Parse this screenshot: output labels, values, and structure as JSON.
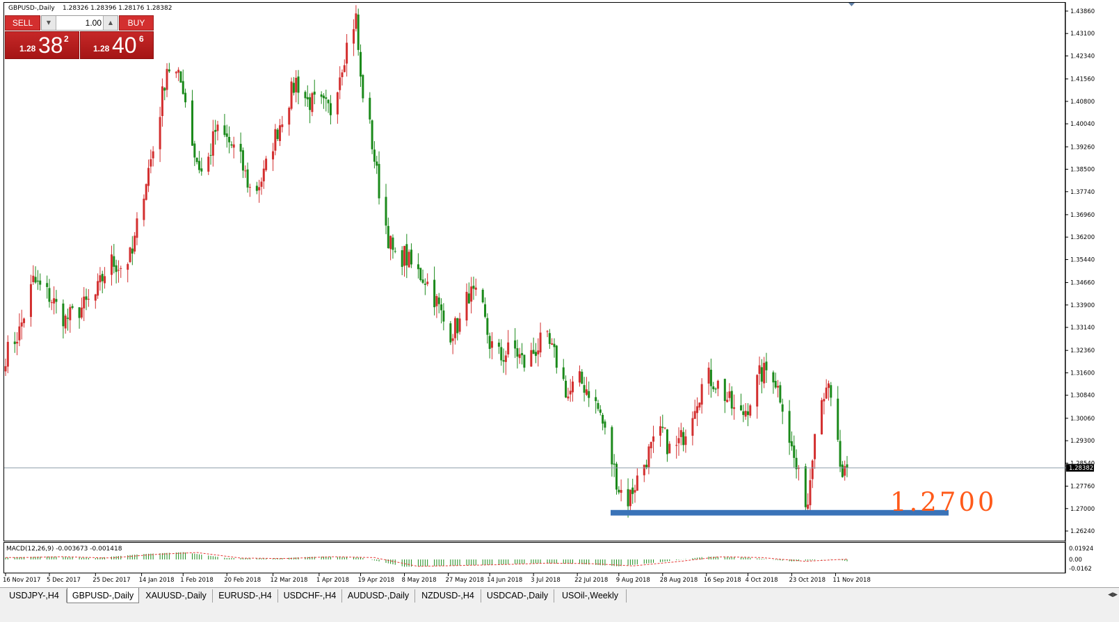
{
  "chart_title": "GBPUSD-,Daily",
  "chart_ohlc": "1.28326 1.28396 1.28176 1.28382",
  "trade_panel": {
    "sell_label": "SELL",
    "buy_label": "BUY",
    "lot_value": "1.00",
    "sell_price": {
      "small": "1.28",
      "big": "38",
      "sup": "2"
    },
    "buy_price": {
      "small": "1.28",
      "big": "40",
      "sup": "6"
    }
  },
  "annotation_text": "1.2700",
  "current_price_label": "1.28382",
  "macd": {
    "label": "MACD(12,26,9) -0.003673 -0.001418",
    "axis_labels": [
      "0.01924",
      "0.00",
      "-0.0162"
    ]
  },
  "tabs": [
    {
      "label": "USDJPY-,H4",
      "active": false
    },
    {
      "label": "GBPUSD-,Daily",
      "active": true
    },
    {
      "label": "XAUUSD-,Daily",
      "active": false
    },
    {
      "label": "EURUSD-,H4",
      "active": false
    },
    {
      "label": "USDCHF-,H4",
      "active": false
    },
    {
      "label": "AUDUSD-,Daily",
      "active": false
    },
    {
      "label": "NZDUSD-,H4",
      "active": false
    },
    {
      "label": "USDCAD-,Daily",
      "active": false
    },
    {
      "label": "USOil-,Weekly",
      "active": false
    }
  ],
  "colors": {
    "bull": "#d32f2f",
    "bear": "#1b8a1b",
    "support_band": "#3a73b8",
    "annotation": "#ff5a1a",
    "signal_line": "#e53935"
  },
  "chart_data": {
    "type": "candlestick",
    "y_ticks": [
      "1.43860",
      "1.43100",
      "1.42340",
      "1.41560",
      "1.40800",
      "1.40040",
      "1.39260",
      "1.38500",
      "1.37740",
      "1.36960",
      "1.36200",
      "1.35440",
      "1.34660",
      "1.33900",
      "1.33140",
      "1.32360",
      "1.31600",
      "1.30840",
      "1.30060",
      "1.29300",
      "1.28540",
      "1.27760",
      "1.27000",
      "1.26240"
    ],
    "x_ticks": [
      "16 Nov 2017",
      "5 Dec 2017",
      "25 Dec 2017",
      "14 Jan 2018",
      "1 Feb 2018",
      "20 Feb 2018",
      "12 Mar 2018",
      "1 Apr 2018",
      "19 Apr 2018",
      "8 May 2018",
      "27 May 2018",
      "14 Jun 2018",
      "3 Jul 2018",
      "22 Jul 2018",
      "9 Aug 2018",
      "28 Aug 2018",
      "16 Sep 2018",
      "4 Oct 2018",
      "23 Oct 2018",
      "11 Nov 2018"
    ],
    "ylim": [
      1.261,
      1.44
    ],
    "support_level": 1.27,
    "current_price": 1.28382,
    "close_path": [
      [
        "16 Nov 2017",
        1.322
      ],
      [
        "22 Nov 2017",
        1.33
      ],
      [
        "28 Nov 2017",
        1.347
      ],
      [
        "5 Dec 2017",
        1.342
      ],
      [
        "12 Dec 2017",
        1.334
      ],
      [
        "19 Dec 2017",
        1.338
      ],
      [
        "25 Dec 2017",
        1.342
      ],
      [
        "31 Dec 2017",
        1.354
      ],
      [
        "5 Jan 2018",
        1.352
      ],
      [
        "10 Jan 2018",
        1.356
      ],
      [
        "14 Jan 2018",
        1.375
      ],
      [
        "20 Jan 2018",
        1.395
      ],
      [
        "25 Jan 2018",
        1.42
      ],
      [
        "28 Jan 2018",
        1.418
      ],
      [
        "1 Feb 2018",
        1.413
      ],
      [
        "6 Feb 2018",
        1.39
      ],
      [
        "10 Feb 2018",
        1.382
      ],
      [
        "15 Feb 2018",
        1.398
      ],
      [
        "20 Feb 2018",
        1.395
      ],
      [
        "25 Feb 2018",
        1.39
      ],
      [
        "3 Mar 2018",
        1.376
      ],
      [
        "8 Mar 2018",
        1.383
      ],
      [
        "12 Mar 2018",
        1.394
      ],
      [
        "17 Mar 2018",
        1.405
      ],
      [
        "22 Mar 2018",
        1.415
      ],
      [
        "27 Mar 2018",
        1.408
      ],
      [
        "1 Apr 2018",
        1.407
      ],
      [
        "6 Apr 2018",
        1.405
      ],
      [
        "10 Apr 2018",
        1.418
      ],
      [
        "15 Apr 2018",
        1.433
      ],
      [
        "17 Apr 2018",
        1.436
      ],
      [
        "19 Apr 2018",
        1.415
      ],
      [
        "23 Apr 2018",
        1.399
      ],
      [
        "27 Apr 2018",
        1.378
      ],
      [
        "1 May 2018",
        1.362
      ],
      [
        "4 May 2018",
        1.354
      ],
      [
        "8 May 2018",
        1.356
      ],
      [
        "12 May 2018",
        1.351
      ],
      [
        "17 May 2018",
        1.348
      ],
      [
        "22 May 2018",
        1.34
      ],
      [
        "27 May 2018",
        1.329
      ],
      [
        "1 Jun 2018",
        1.333
      ],
      [
        "5 Jun 2018",
        1.343
      ],
      [
        "10 Jun 2018",
        1.34
      ],
      [
        "14 Jun 2018",
        1.326
      ],
      [
        "19 Jun 2018",
        1.321
      ],
      [
        "24 Jun 2018",
        1.325
      ],
      [
        "29 Jun 2018",
        1.319
      ],
      [
        "3 Jul 2018",
        1.323
      ],
      [
        "8 Jul 2018",
        1.328
      ],
      [
        "13 Jul 2018",
        1.32
      ],
      [
        "18 Jul 2018",
        1.308
      ],
      [
        "22 Jul 2018",
        1.314
      ],
      [
        "27 Jul 2018",
        1.31
      ],
      [
        "1 Aug 2018",
        1.302
      ],
      [
        "5 Aug 2018",
        1.289
      ],
      [
        "9 Aug 2018",
        1.277
      ],
      [
        "13 Aug 2018",
        1.273
      ],
      [
        "17 Aug 2018",
        1.28
      ],
      [
        "22 Aug 2018",
        1.289
      ],
      [
        "28 Aug 2018",
        1.296
      ],
      [
        "1 Sep 2018",
        1.288
      ],
      [
        "6 Sep 2018",
        1.295
      ],
      [
        "11 Sep 2018",
        1.306
      ],
      [
        "16 Sep 2018",
        1.315
      ],
      [
        "21 Sep 2018",
        1.312
      ],
      [
        "26 Sep 2018",
        1.306
      ],
      [
        "30 Sep 2018",
        1.3
      ],
      [
        "4 Oct 2018",
        1.305
      ],
      [
        "9 Oct 2018",
        1.315
      ],
      [
        "14 Oct 2018",
        1.318
      ],
      [
        "19 Oct 2018",
        1.306
      ],
      [
        "23 Oct 2018",
        1.29
      ],
      [
        "27 Oct 2018",
        1.277
      ],
      [
        "30 Oct 2018",
        1.272
      ],
      [
        "2 Nov 2018",
        1.299
      ],
      [
        "7 Nov 2018",
        1.313
      ],
      [
        "11 Nov 2018",
        1.298
      ],
      [
        "14 Nov 2018",
        1.278
      ],
      [
        "16 Nov 2018",
        1.2838
      ]
    ],
    "macd_histogram_profile": [
      [
        "16 Nov 2017",
        0.004
      ],
      [
        "5 Dec 2017",
        0.006
      ],
      [
        "25 Dec 2017",
        0.003
      ],
      [
        "14 Jan 2018",
        0.011
      ],
      [
        "1 Feb 2018",
        0.015
      ],
      [
        "20 Feb 2018",
        0.003
      ],
      [
        "12 Mar 2018",
        0.002
      ],
      [
        "1 Apr 2018",
        0.006
      ],
      [
        "19 Apr 2018",
        0.004
      ],
      [
        "8 May 2018",
        -0.015
      ],
      [
        "27 May 2018",
        -0.013
      ],
      [
        "14 Jun 2018",
        -0.011
      ],
      [
        "3 Jul 2018",
        -0.008
      ],
      [
        "22 Jul 2018",
        -0.009
      ],
      [
        "9 Aug 2018",
        -0.014
      ],
      [
        "28 Aug 2018",
        -0.005
      ],
      [
        "16 Sep 2018",
        0.006
      ],
      [
        "4 Oct 2018",
        0.004
      ],
      [
        "23 Oct 2018",
        -0.004
      ],
      [
        "11 Nov 2018",
        0.001
      ],
      [
        "16 Nov 2018",
        -0.0037
      ]
    ]
  }
}
